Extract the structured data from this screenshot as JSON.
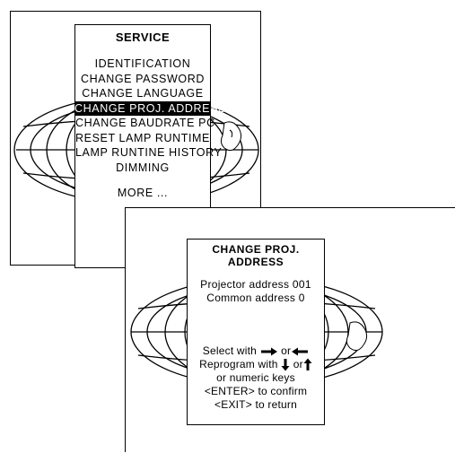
{
  "service_menu": {
    "title": "SERVICE",
    "items": [
      {
        "label": "IDENTIFICATION",
        "selected": false
      },
      {
        "label": "CHANGE PASSWORD",
        "selected": false
      },
      {
        "label": "CHANGE LANGUAGE",
        "selected": false
      },
      {
        "label": "CHANGE PROJ. ADDRESS",
        "selected": true
      },
      {
        "label": "CHANGE BAUDRATE PC",
        "selected": false
      },
      {
        "label": "RESET LAMP RUNTIME",
        "selected": false
      },
      {
        "label": "LAMP RUNTINE HISTORY",
        "selected": false
      },
      {
        "label": "DIMMING",
        "selected": false
      }
    ],
    "more_label": "MORE ..."
  },
  "change_address_menu": {
    "title": "CHANGE PROJ. ADDRESS",
    "projector_address": "Projector address 001",
    "common_address": "Common address 0",
    "help": {
      "select_with": "Select with",
      "select_or": "or",
      "reprogram_with": "Reprogram with",
      "reprogram_or": "or",
      "numeric_keys": "or numeric keys",
      "enter_confirm": "<ENTER> to confirm",
      "exit_return": "<EXIT> to return"
    }
  },
  "icons": {
    "select_arrows": [
      "arrow-right-icon",
      "arrow-left-icon"
    ],
    "reprogram_arrows": [
      "arrow-down-icon",
      "arrow-up-icon"
    ],
    "background": "globe-icon"
  },
  "colors": {
    "foreground": "#000000",
    "background": "#ffffff",
    "selected_bg": "#000000",
    "selected_fg": "#ffffff"
  }
}
